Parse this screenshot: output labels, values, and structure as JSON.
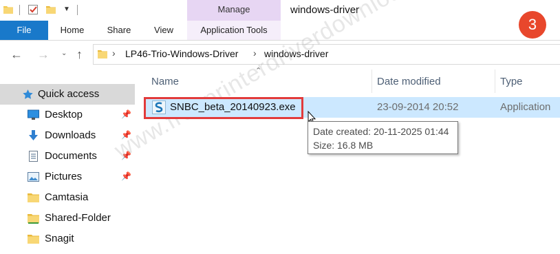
{
  "window": {
    "title": "windows-driver"
  },
  "ribbon": {
    "context_group": "Manage",
    "tabs": {
      "file": "File",
      "home": "Home",
      "share": "Share",
      "view": "View",
      "application_tools": "Application Tools"
    }
  },
  "badge": {
    "step": "3"
  },
  "address": {
    "crumbs": [
      "LP46-Trio-Windows-Driver",
      "windows-driver"
    ]
  },
  "nav": {
    "quick_access": "Quick access",
    "items": [
      {
        "label": "Desktop",
        "pinned": true,
        "icon": "desktop-icon"
      },
      {
        "label": "Downloads",
        "pinned": true,
        "icon": "download-arrow-icon"
      },
      {
        "label": "Documents",
        "pinned": true,
        "icon": "documents-icon"
      },
      {
        "label": "Pictures",
        "pinned": true,
        "icon": "pictures-icon"
      },
      {
        "label": "Camtasia",
        "pinned": false,
        "icon": "folder-icon"
      },
      {
        "label": "Shared-Folder",
        "pinned": false,
        "icon": "shared-folder-icon"
      },
      {
        "label": "Snagit",
        "pinned": false,
        "icon": "folder-icon"
      }
    ]
  },
  "columns": {
    "name": "Name",
    "date_modified": "Date modified",
    "type": "Type"
  },
  "files": [
    {
      "name": "SNBC_beta_20140923.exe",
      "date_modified": "23-09-2014 20:52",
      "type": "Application"
    }
  ],
  "tooltip": {
    "date_created": "Date created: 20-11-2025 01:44",
    "size": "Size: 16.8 MB"
  },
  "watermark": "www.freeprinterdriverdownload.org",
  "colors": {
    "accent": "#1979ca",
    "manage_tab": "#e7d6f3",
    "selection": "#cce8ff",
    "highlight": "#e23b3b",
    "badge": "#e8472c"
  }
}
